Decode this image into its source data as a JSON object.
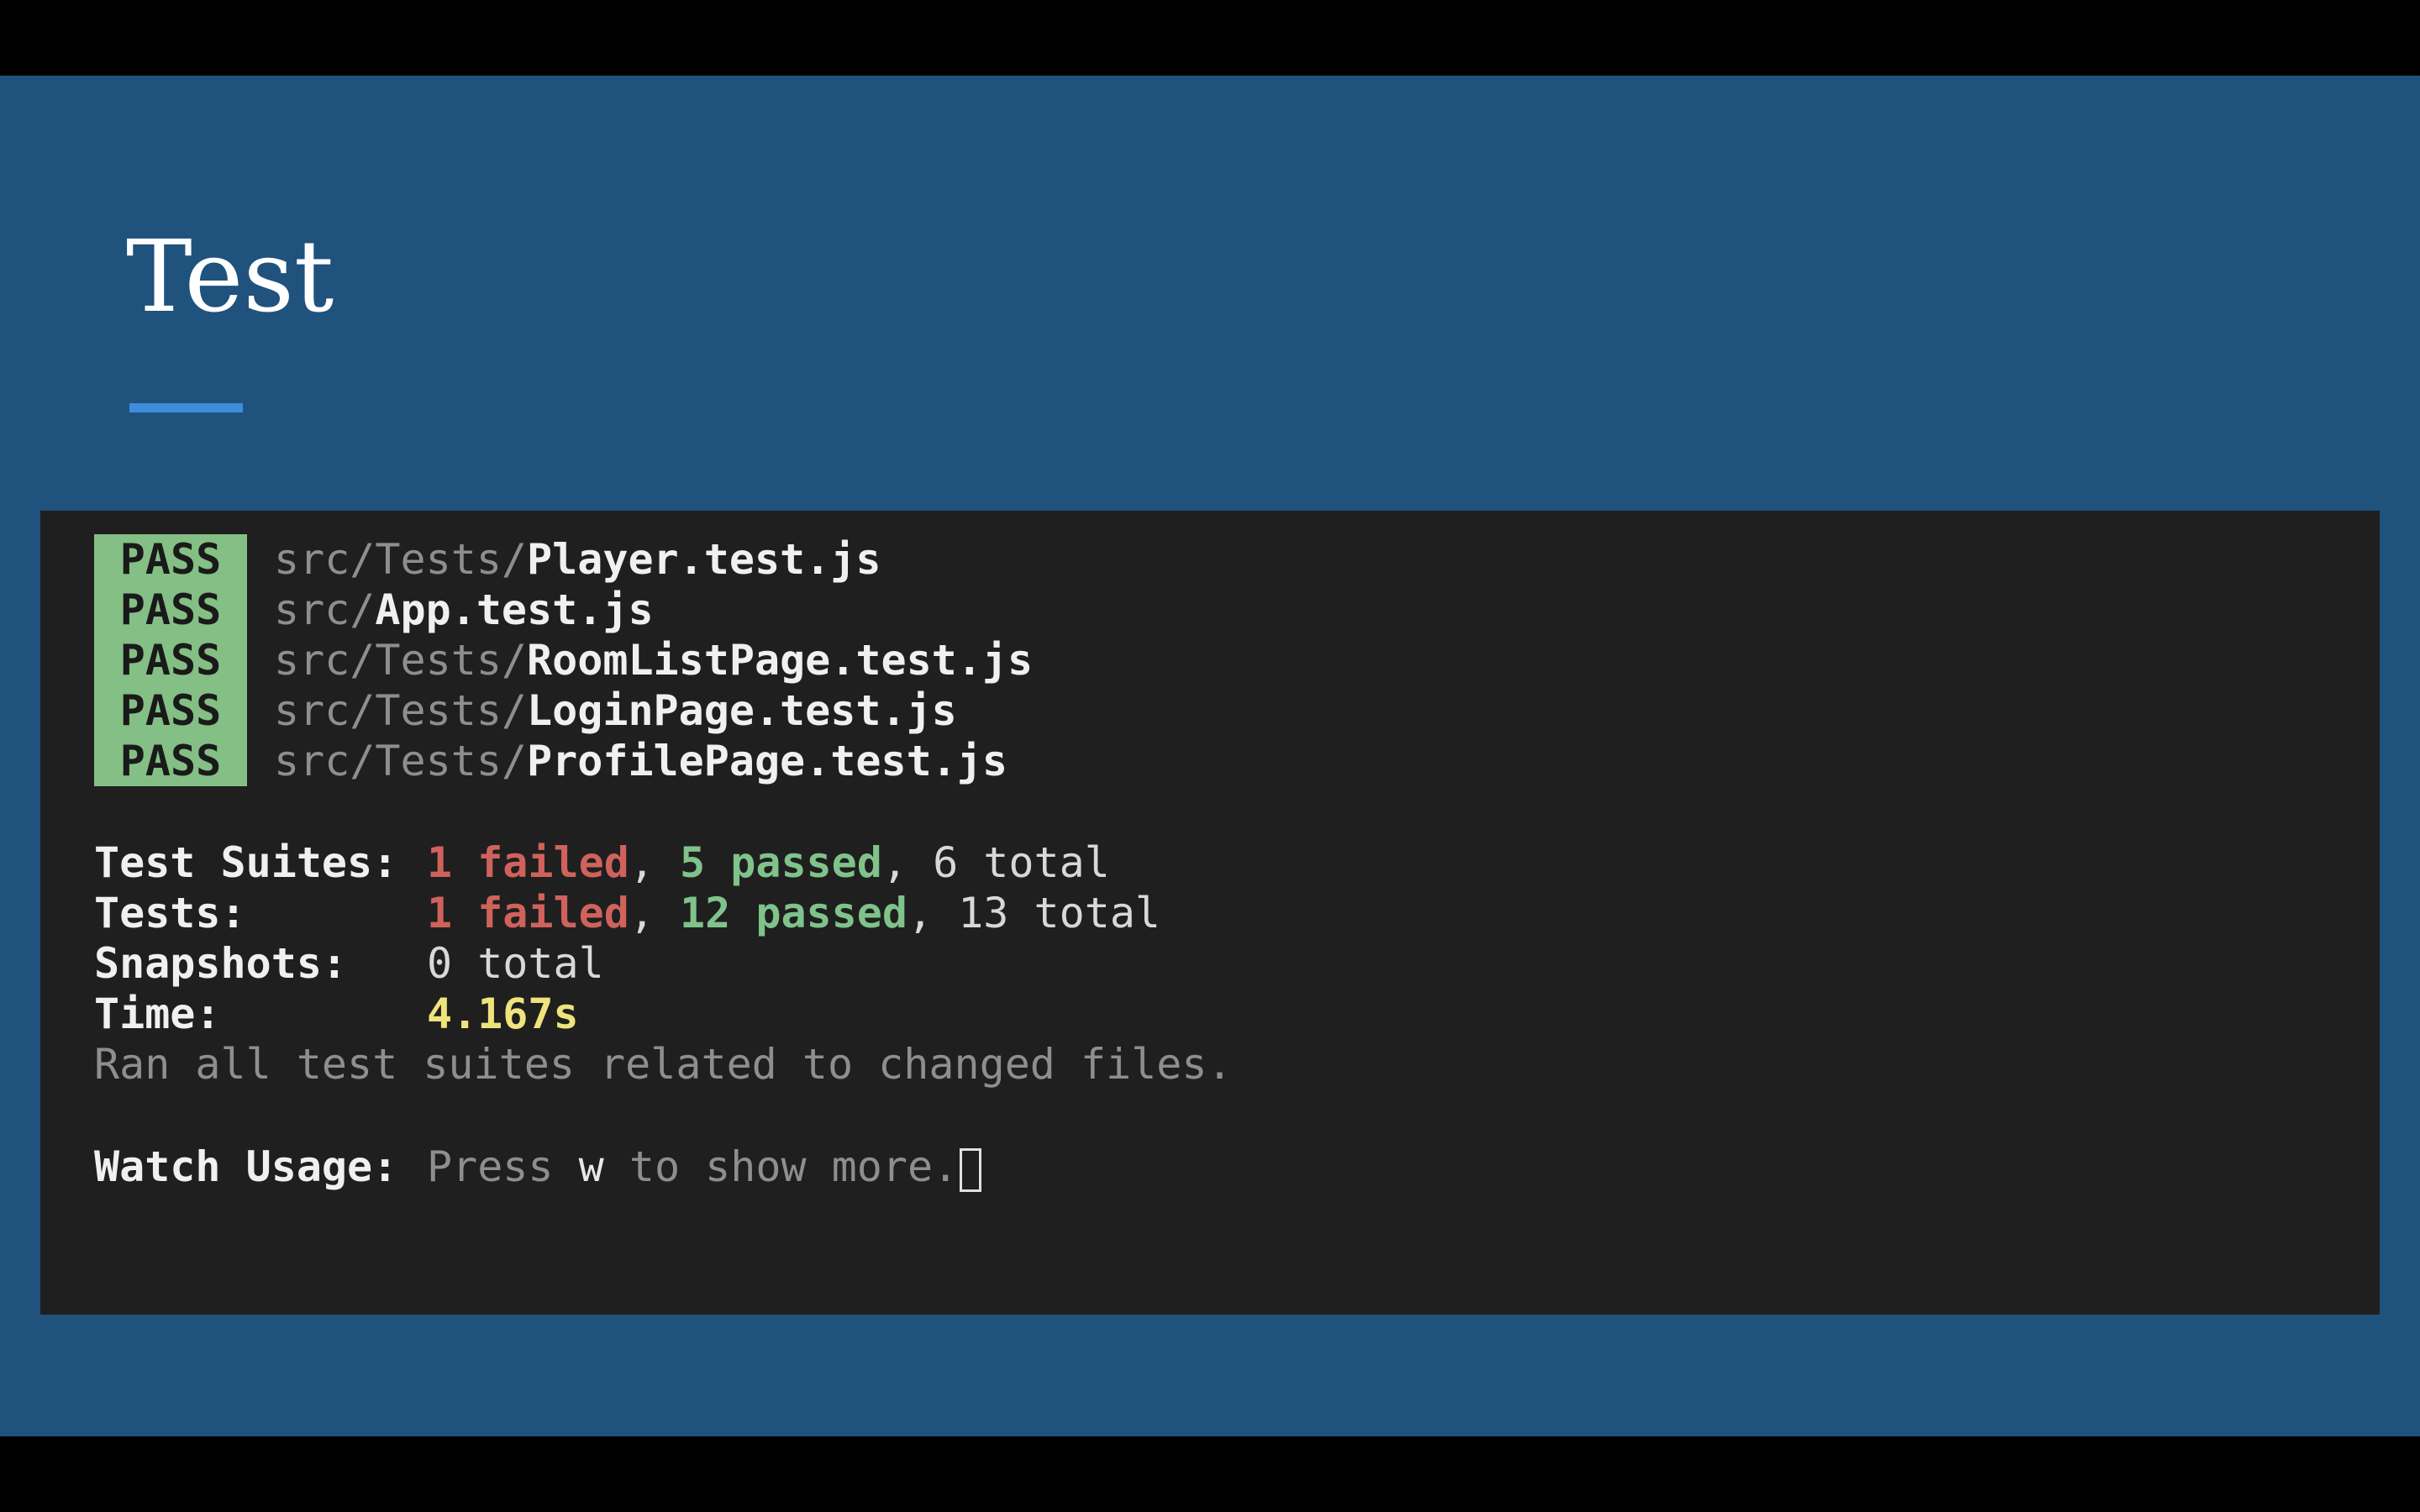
{
  "slide": {
    "title": "Test"
  },
  "terminal": {
    "results": [
      {
        "status": "PASS",
        "dir": "src/Tests/",
        "file": "Player.test.js"
      },
      {
        "status": "PASS",
        "dir": "src/",
        "file": "App.test.js"
      },
      {
        "status": "PASS",
        "dir": "src/Tests/",
        "file": "RoomListPage.test.js"
      },
      {
        "status": "PASS",
        "dir": "src/Tests/",
        "file": "LoginPage.test.js"
      },
      {
        "status": "PASS",
        "dir": "src/Tests/",
        "file": "ProfilePage.test.js"
      }
    ],
    "summary": {
      "suites_label": "Test Suites:",
      "suites_failed": "1 failed",
      "suites_passed": "5 passed",
      "suites_total": "6 total",
      "tests_label": "Tests:",
      "tests_failed": "1 failed",
      "tests_passed": "12 passed",
      "tests_total": "13 total",
      "snapshots_label": "Snapshots:",
      "snapshots_total": "0 total",
      "time_label": "Time:",
      "time_value": "4.167s",
      "ran_note": "Ran all test suites related to changed files."
    },
    "watch": {
      "label": "Watch Usage:",
      "press": "Press ",
      "key": "w",
      "rest": " to show more."
    }
  },
  "colors": {
    "slide_background": "#1f527c",
    "accent_underline": "#3d8ddb",
    "terminal_background": "#1f1f1f",
    "pass_badge": "#84bf85",
    "failed": "#d0625c",
    "passed": "#7fc38a",
    "time": "#efe37c"
  }
}
